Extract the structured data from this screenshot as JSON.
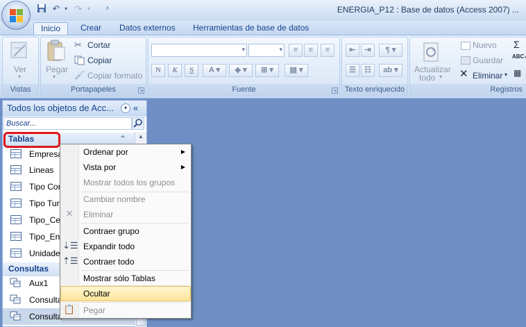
{
  "window": {
    "title": "ENERGIA_P12 : Base de datos (Access 2007) ..."
  },
  "tabs": [
    {
      "label": "Inicio"
    },
    {
      "label": "Crear"
    },
    {
      "label": "Datos externos"
    },
    {
      "label": "Herramientas de base de datos"
    }
  ],
  "ribbon": {
    "vistas": {
      "label": "Vistas",
      "ver": "Ver"
    },
    "portapapeles": {
      "label": "Portapapeles",
      "pegar": "Pegar",
      "cortar": "Cortar",
      "copiar": "Copiar",
      "copiar_formato": "Copiar formato"
    },
    "fuente": {
      "label": "Fuente"
    },
    "texto_enriquecido": {
      "label": "Texto enriquecido"
    },
    "registros": {
      "label": "Registros",
      "actualizar": "Actualizar",
      "todo": "todo",
      "nuevo": "Nuevo",
      "guardar": "Guardar",
      "eliminar": "Eliminar"
    }
  },
  "nav": {
    "header": "Todos los objetos de Acc...",
    "search_placeholder": "Buscar...",
    "sections": [
      {
        "label": "Tablas",
        "items": [
          "Empresa",
          "Lineas",
          "Tipo Cor",
          "Tipo Turb",
          "Tipo_Cer",
          "Tipo_Ene",
          "Unidade"
        ]
      },
      {
        "label": "Consultas",
        "items": [
          "Aux1",
          "Consulta",
          "Consulta"
        ]
      }
    ]
  },
  "context_menu": {
    "items": [
      {
        "label": "Ordenar por",
        "enabled": true,
        "submenu": true
      },
      {
        "label": "Vista por",
        "enabled": true,
        "submenu": true
      },
      {
        "label": "Mostrar todos los grupos",
        "enabled": false
      },
      {
        "label": "Cambiar nombre",
        "enabled": false
      },
      {
        "label": "Eliminar",
        "enabled": false
      },
      {
        "label": "Contraer grupo",
        "enabled": true
      },
      {
        "label": "Expandir todo",
        "enabled": true
      },
      {
        "label": "Contraer todo",
        "enabled": true
      },
      {
        "label": "Mostrar sólo Tablas",
        "enabled": true
      },
      {
        "label": "Ocultar",
        "enabled": true,
        "highlighted": true
      },
      {
        "label": "Pegar",
        "enabled": false
      }
    ]
  },
  "colors": {
    "accent": "#15428b",
    "workspace": "#6f8fc4",
    "highlight_box": "#e0161b"
  }
}
